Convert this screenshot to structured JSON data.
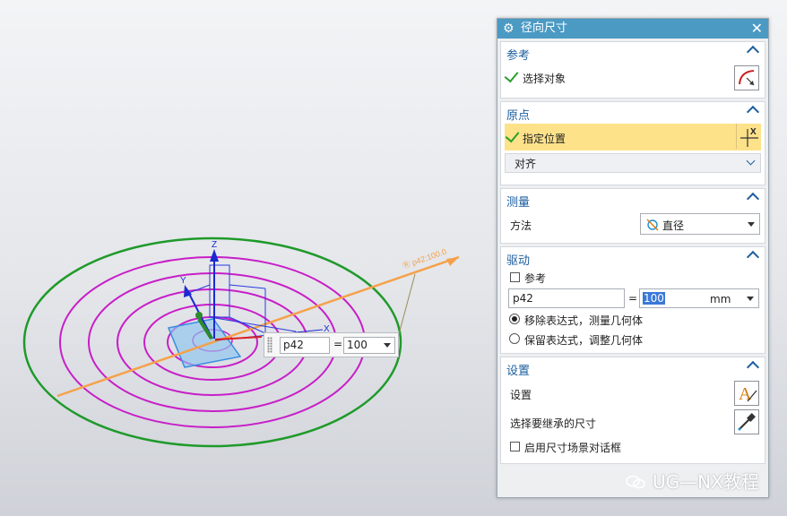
{
  "dialog": {
    "title": "径向尺寸",
    "close_label": "✕",
    "reference": {
      "heading": "参考",
      "select_object_label": "选择对象"
    },
    "origin": {
      "heading": "原点",
      "specify_location_label": "指定位置",
      "align_label": "对齐"
    },
    "measure": {
      "heading": "测量",
      "method_label": "方法",
      "method_value": "直径"
    },
    "drive": {
      "heading": "驱动",
      "reference_checkbox_label": "参考",
      "expression_name": "p42",
      "equals": "=",
      "value": "100",
      "unit": "mm",
      "option_remove_label": "移除表达式，测量几何体",
      "option_keep_label": "保留表达式，调整几何体",
      "selected_option": "remove"
    },
    "settings": {
      "heading": "设置",
      "settings_label": "设置",
      "inherit_label": "选择要继承的尺寸",
      "enable_dialog_label": "启用尺寸场景对话框"
    }
  },
  "viewport": {
    "inline_expression": {
      "name": "p42",
      "equals": "=",
      "value": "100"
    },
    "dimension_label": "Ⓡ p42:100.0",
    "axis_labels": {
      "z": "Z",
      "y": "Y",
      "x": "X"
    },
    "colors": {
      "outer_circle": "#1f9a2a",
      "inner_circles": "#c81ec8",
      "dimension_line": "#f5a14a",
      "csys": "#2a3adf",
      "plane": "#6aaee8"
    }
  },
  "watermark": {
    "text": "UG—NX教程"
  }
}
